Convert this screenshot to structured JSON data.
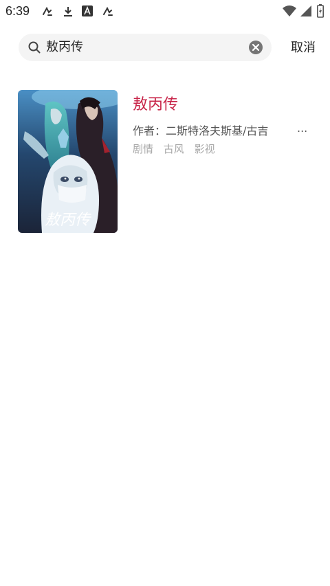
{
  "status_bar": {
    "time": "6:39",
    "left_icons": [
      "swift-key-icon",
      "download-icon",
      "font-a-icon",
      "swift-key-icon"
    ],
    "right_icons": [
      "wifi-icon",
      "signal-icon",
      "battery-icon"
    ]
  },
  "search": {
    "value": "敖丙传",
    "cancel_label": "取消"
  },
  "results": [
    {
      "title": "敖丙传",
      "author": "作者：二斯特洛夫斯基/古吉",
      "author_overflow": "...",
      "tags": [
        "剧情",
        "古风",
        "影视"
      ],
      "cover_text": "敖丙传"
    }
  ],
  "colors": {
    "title_accent": "#c8264a",
    "search_bg": "#f4f4f4",
    "tag_text": "#a8a8a8"
  }
}
